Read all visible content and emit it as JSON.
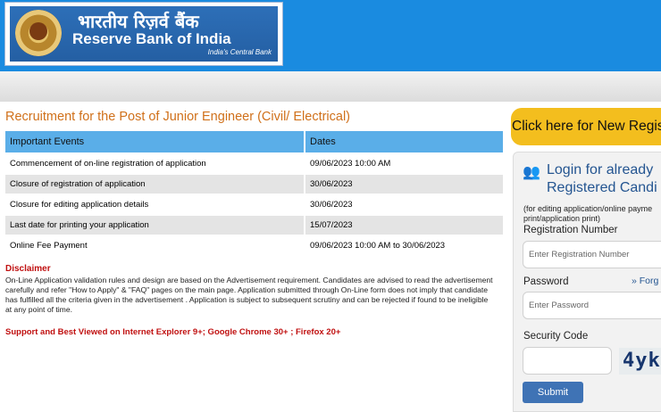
{
  "header": {
    "hindi_name": "भारतीय रिज़र्व बैंक",
    "english_name": "Reserve Bank of India",
    "tagline": "India's Central Bank"
  },
  "main": {
    "title": "Recruitment for the Post of Junior Engineer (Civil/ Electrical)",
    "table": {
      "headers": [
        "Important Events",
        "Dates"
      ],
      "rows": [
        [
          "Commencement of on-line registration of application",
          "09/06/2023 10:00 AM"
        ],
        [
          "Closure of registration of application",
          "30/06/2023"
        ],
        [
          "Closure for editing application details",
          "30/06/2023"
        ],
        [
          "Last date for printing your application",
          "15/07/2023"
        ],
        [
          "Online Fee Payment",
          "09/06/2023 10:00 AM to 30/06/2023"
        ]
      ]
    },
    "disclaimer_title": "Disclaimer",
    "disclaimer_text": "On-Line Application validation rules and design are based on the Advertisement requirement. Candidates are advised to read the advertisement carefully and refer \"How to Apply\" & \"FAQ\" pages on the main page. Application submitted through On-Line form does not imply that candidate has fulfilled all the criteria given in the advertisement . Application is subject to subsequent scrutiny and can be rejected if found to be ineligible at any point of time.",
    "support_text": "Support and Best Viewed on Internet Explorer 9+; Google Chrome 30+ ; Firefox 20+"
  },
  "sidebar": {
    "new_registration": "Click here for New Regist",
    "login_title_line1": "Login for already",
    "login_title_line2": "Registered Candi",
    "login_note_line1": "(for editing application/online payme",
    "login_note_line2": "print/application print)",
    "registration_label": "Registration Number",
    "registration_placeholder": "Enter Registration Number",
    "password_label": "Password",
    "password_placeholder": "Enter Password",
    "forgot_label": "Forg",
    "security_label": "Security Code",
    "captcha_text": "4yk",
    "submit_label": "Submit"
  },
  "colors": {
    "header_blue": "#1a8be0",
    "title_orange": "#d0701a",
    "table_header": "#5aaee8",
    "new_reg_yellow": "#f3be1e",
    "disclaimer_red": "#c01010",
    "submit_blue": "#3f73b5"
  },
  "icons": {
    "user_icon": "users-icon",
    "forgot_icon": "double-chevron-right-icon"
  }
}
